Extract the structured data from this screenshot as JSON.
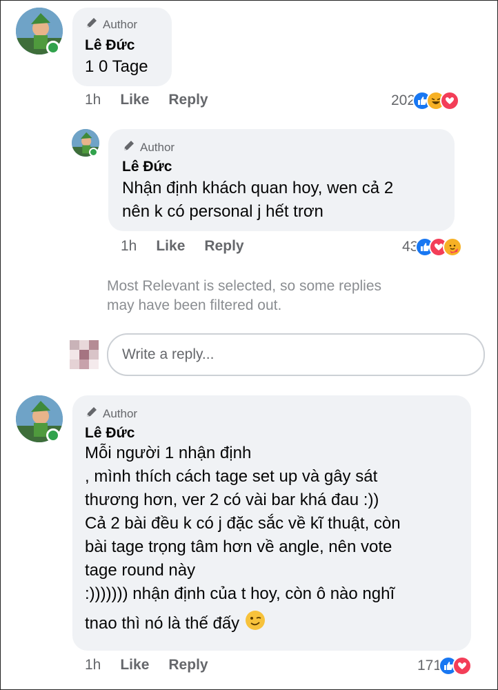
{
  "comments": [
    {
      "badge": "Author",
      "name": "Lê Đức",
      "text": "1 0 Tage",
      "time": "1h",
      "like_label": "Like",
      "reply_label": "Reply",
      "reaction_count": "202",
      "reactions": [
        "like",
        "haha",
        "love"
      ]
    },
    {
      "badge": "Author",
      "name": "Lê Đức",
      "text_lines": [
        "Nhận định khách quan hoy, wen cả 2",
        "nên k có personal  j hết trơn"
      ],
      "time": "1h",
      "like_label": "Like",
      "reply_label": "Reply",
      "reaction_count": "43",
      "reactions": [
        "like",
        "love",
        "care"
      ]
    },
    {
      "badge": "Author",
      "name": "Lê Đức",
      "text_lines": [
        "Mỗi người 1 nhận định",
        ", mình thích cách tage set up và gây sát",
        "thương hơn, ver 2 có vài bar khá đau :))",
        "Cả 2 bài đều k có j đặc sắc về kĩ thuật, còn",
        "bài tage trọng tâm hơn về angle, nên vote",
        "tage round này",
        ":))))))) nhận định của t hoy, còn ô nào nghĩ",
        "tnao thì nó là thế đấy"
      ],
      "emoji": "wink",
      "time": "1h",
      "like_label": "Like",
      "reply_label": "Reply",
      "reaction_count": "171",
      "reactions": [
        "like",
        "love"
      ]
    }
  ],
  "filter_notice": [
    "Most Relevant is selected, so some replies",
    "may have been filtered out."
  ],
  "reply_box": {
    "placeholder": "Write a reply..."
  },
  "colors": {
    "like": "#1877f2",
    "love": "#f33e58",
    "haha": "#f7b125",
    "care": "#f7b125",
    "online": "#31a24c"
  }
}
